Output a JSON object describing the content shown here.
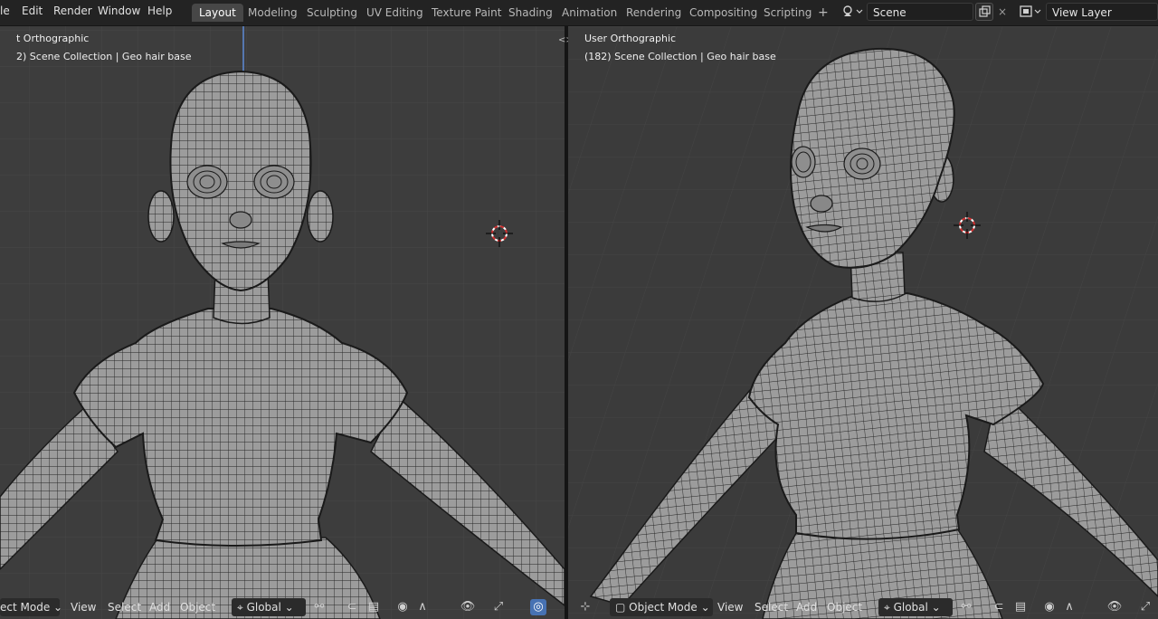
{
  "menu": [
    "le",
    "Edit",
    "Render",
    "Window",
    "Help"
  ],
  "workspaces": [
    "Layout",
    "Modeling",
    "Sculpting",
    "UV Editing",
    "Texture Paint",
    "Shading",
    "Animation",
    "Rendering",
    "Compositing",
    "Scripting"
  ],
  "add_workspace": "+",
  "scene": {
    "name": "Scene",
    "close": "×"
  },
  "view_layer": {
    "name": "View Layer"
  },
  "split_arrows": "<>",
  "viewport_left": {
    "title": "t Orthographic",
    "subtitle": "2) Scene Collection | Geo hair base",
    "footer": {
      "mode": "ect Mode",
      "view": "View",
      "select": "Select",
      "add": "Add",
      "object": "Object",
      "orientation": "Global"
    }
  },
  "viewport_right": {
    "title": "User Orthographic",
    "subtitle": "(182) Scene Collection | Geo hair base",
    "footer": {
      "mode": "Object Mode",
      "view": "View",
      "select": "Select",
      "add": "Add",
      "object": "Object",
      "orientation": "Global"
    }
  },
  "colors": {
    "viewport_bg": "#3d3d3d",
    "grid": "#484848",
    "mesh": "#9a9a9a",
    "wire": "#1a1a1a",
    "active_tab": "#474747",
    "cursor": "#d03030"
  }
}
